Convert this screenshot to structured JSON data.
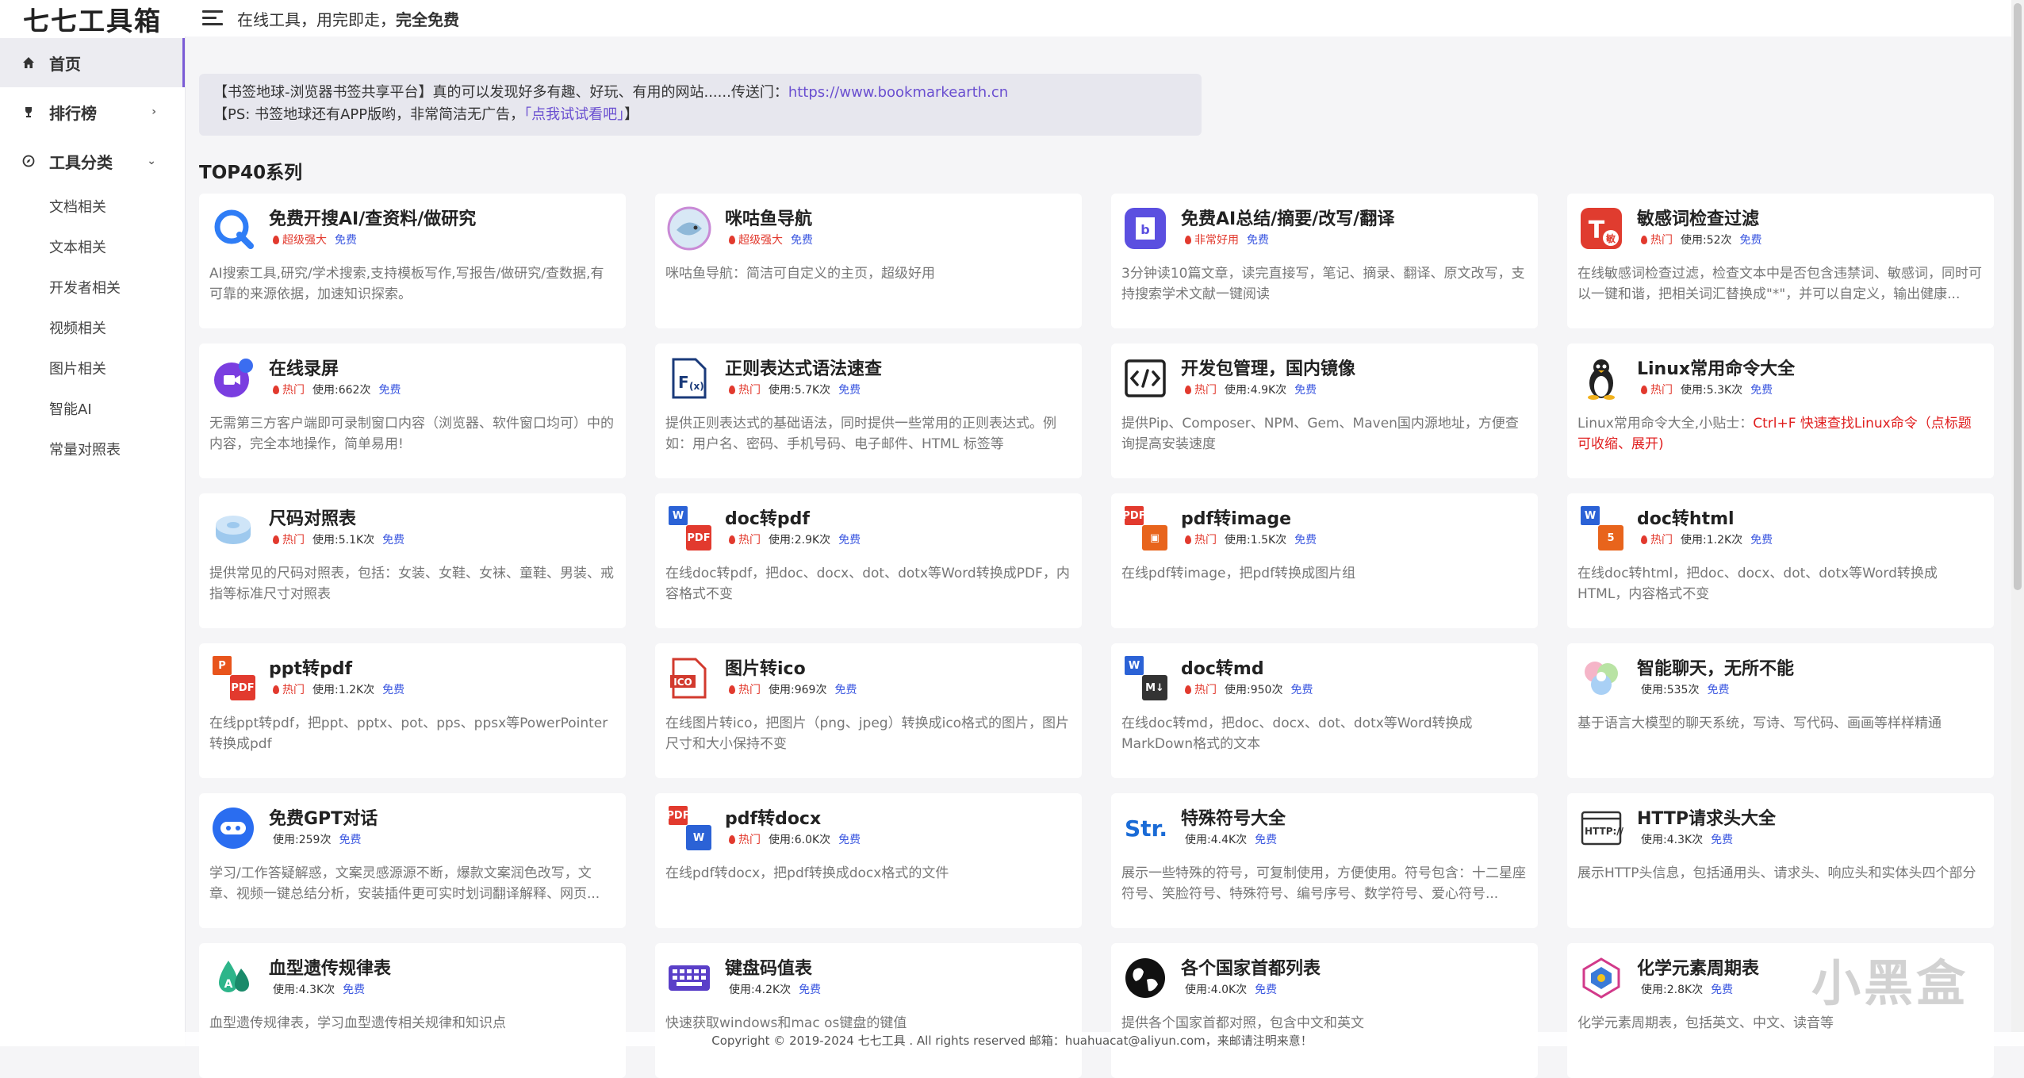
{
  "app": {
    "logo": "七七工具箱",
    "header_text": "在线工具，用完即走，",
    "header_bold": "完全免费"
  },
  "sidebar": {
    "nav": [
      {
        "label": "首页",
        "icon": "home-icon",
        "active": true
      },
      {
        "label": "排行榜",
        "icon": "trophy-icon",
        "arrow": "›"
      },
      {
        "label": "工具分类",
        "icon": "compass-icon",
        "arrow": "⌄"
      }
    ],
    "sub_items": [
      "文档相关",
      "文本相关",
      "开发者相关",
      "视频相关",
      "图片相关",
      "智能AI",
      "常量对照表"
    ]
  },
  "notice": {
    "line1_text": "【书签地球-浏览器书签共享平台】真的可以发现好多有趣、好玩、有用的网站......传送门：",
    "line1_link": "https://www.bookmarkearth.cn",
    "line2_prefix": "【PS: 书签地球还有APP版哟，非常简洁无广告，",
    "line2_link": "「点我试试看吧」",
    "line2_suffix": "】"
  },
  "section_title": "TOP40系列",
  "cards": [
    {
      "title": "免费开搜AI/查资料/做研究",
      "tag": "超级强大",
      "uses": "",
      "free": "免费",
      "desc": "AI搜索工具,研究/学术搜索,支持模板写作,写报告/做研究/查数据,有可靠的来源依据，加速知识探索。",
      "icon": "kaisou-icon"
    },
    {
      "title": "咪咕鱼导航",
      "tag": "超级强大",
      "uses": "",
      "free": "免费",
      "desc": "咪咕鱼导航：简洁可自定义的主页，超级好用",
      "icon": "fish-icon"
    },
    {
      "title": "免费AI总结/摘要/改写/翻译",
      "tag": "非常好用",
      "uses": "",
      "free": "免费",
      "desc": "3分钟读10篇文章，读完直接写，笔记、摘录、翻译、原文改写，支持搜索学术文献一键阅读",
      "icon": "book-icon"
    },
    {
      "title": "敏感词检查过滤",
      "tag": "热门",
      "uses": "使用:52次",
      "free": "免费",
      "desc": "在线敏感词检查过滤，检查文本中是否包含违禁词、敏感词，同时可以一键和谐，把相关词汇替换成\"*\"，并可以自定义，输出健康...",
      "icon": "sensitive-word-icon"
    },
    {
      "title": "在线录屏",
      "tag": "热门",
      "uses": "使用:662次",
      "free": "免费",
      "desc": "无需第三方客户端即可录制窗口内容（浏览器、软件窗口均可）中的内容，完全本地操作，简单易用!",
      "icon": "screen-record-icon"
    },
    {
      "title": "正则表达式语法速查",
      "tag": "热门",
      "uses": "使用:5.7K次",
      "free": "免费",
      "desc": "提供正则表达式的基础语法，同时提供一些常用的正则表达式。例如：用户名、密码、手机号码、电子邮件、HTML 标签等",
      "icon": "regex-icon"
    },
    {
      "title": "开发包管理，国内镜像",
      "tag": "热门",
      "uses": "使用:4.9K次",
      "free": "免费",
      "desc": "提供Pip、Composer、NPM、Gem、Maven国内源地址，方便查询提高安装速度",
      "icon": "code-icon"
    },
    {
      "title": "Linux常用命令大全",
      "tag": "热门",
      "uses": "使用:5.3K次",
      "free": "免费",
      "desc": "Linux常用命令大全,小贴士：",
      "desc_red": "Ctrl+F 快速查找Linux命令（点标题可收缩、展开)",
      "icon": "linux-penguin-icon"
    },
    {
      "title": "尺码对照表",
      "tag": "热门",
      "uses": "使用:5.1K次",
      "free": "免费",
      "desc": "提供常见的尺码对照表，包括：女装、女鞋、女袜、童鞋、男装、戒指等标准尺寸对照表",
      "icon": "tape-measure-icon"
    },
    {
      "title": "doc转pdf",
      "tag": "热门",
      "uses": "使用:2.9K次",
      "free": "免费",
      "desc": "在线doc转pdf，把doc、docx、dot、dotx等Word转换成PDF，内容格式不变",
      "icon": "doc-to-pdf-icon"
    },
    {
      "title": "pdf转image",
      "tag": "热门",
      "uses": "使用:1.5K次",
      "free": "免费",
      "desc": "在线pdf转image，把pdf转换成图片组",
      "icon": "pdf-to-image-icon"
    },
    {
      "title": "doc转html",
      "tag": "热门",
      "uses": "使用:1.2K次",
      "free": "免费",
      "desc": "在线doc转html，把doc、docx、dot、dotx等Word转换成HTML，内容格式不变",
      "icon": "doc-to-html-icon"
    },
    {
      "title": "ppt转pdf",
      "tag": "热门",
      "uses": "使用:1.2K次",
      "free": "免费",
      "desc": "在线ppt转pdf，把ppt、pptx、pot、pps、ppsx等PowerPointer转换成pdf",
      "icon": "ppt-to-pdf-icon"
    },
    {
      "title": "图片转ico",
      "tag": "热门",
      "uses": "使用:969次",
      "free": "免费",
      "desc": "在线图片转ico，把图片（png、jpeg）转换成ico格式的图片，图片尺寸和大小保持不变",
      "icon": "image-to-ico-icon"
    },
    {
      "title": "doc转md",
      "tag": "热门",
      "uses": "使用:950次",
      "free": "免费",
      "desc": "在线doc转md，把doc、docx、dot、dotx等Word转换成MarkDown格式的文本",
      "icon": "doc-to-md-icon"
    },
    {
      "title": "智能聊天，无所不能",
      "tag": "",
      "uses": "使用:535次",
      "free": "免费",
      "desc": "基于语言大模型的聊天系统，写诗、写代码、画画等样样精通",
      "icon": "chat-bubbles-icon"
    },
    {
      "title": "免费GPT对话",
      "tag": "",
      "uses": "使用:259次",
      "free": "免费",
      "desc": "学习/工作答疑解惑，文案灵感源源不断，爆款文案润色改写，文章、视频一键总结分析，安装插件更可实时划词翻译解释、网页...",
      "icon": "gpt-icon"
    },
    {
      "title": "pdf转docx",
      "tag": "热门",
      "uses": "使用:6.0K次",
      "free": "免费",
      "desc": "在线pdf转docx，把pdf转换成docx格式的文件",
      "icon": "pdf-to-docx-icon"
    },
    {
      "title": "特殊符号大全",
      "tag": "",
      "uses": "使用:4.4K次",
      "free": "免费",
      "desc": "展示一些特殊的符号，可复制使用，方便使用。符号包含：十二星座符号、笑脸符号、特殊符号、编号序号、数学符号、爱心符号...",
      "icon": "str-symbol-icon"
    },
    {
      "title": "HTTP请求头大全",
      "tag": "",
      "uses": "使用:4.3K次",
      "free": "免费",
      "desc": "展示HTTP头信息，包括通用头、请求头、响应头和实体头四个部分",
      "icon": "http-icon"
    },
    {
      "title": "血型遗传规律表",
      "tag": "",
      "uses": "使用:4.3K次",
      "free": "免费",
      "desc": "血型遗传规律表，学习血型遗传相关规律和知识点",
      "icon": "blood-drop-icon"
    },
    {
      "title": "键盘码值表",
      "tag": "",
      "uses": "使用:4.2K次",
      "free": "免费",
      "desc": "快速获取windows和mac os键盘的键值",
      "icon": "keyboard-icon"
    },
    {
      "title": "各个国家首都列表",
      "tag": "",
      "uses": "使用:4.0K次",
      "free": "免费",
      "desc": "提供各个国家首都对照，包含中文和英文",
      "icon": "globe-icon"
    },
    {
      "title": "化学元素周期表",
      "tag": "",
      "uses": "使用:2.8K次",
      "free": "免费",
      "desc": "化学元素周期表，包括英文、中文、读音等",
      "icon": "chemistry-icon"
    }
  ],
  "footer": "Copyright © 2019-2024 七七工具 . All rights reserved 邮箱：huahuacat@aliyun.com，来邮请注明来意！",
  "watermark": "小黑盒",
  "colors": {
    "accent": "#7b5cd6",
    "hot": "#e23a2e",
    "free": "#3b57e0",
    "link": "#6a4fd0"
  }
}
